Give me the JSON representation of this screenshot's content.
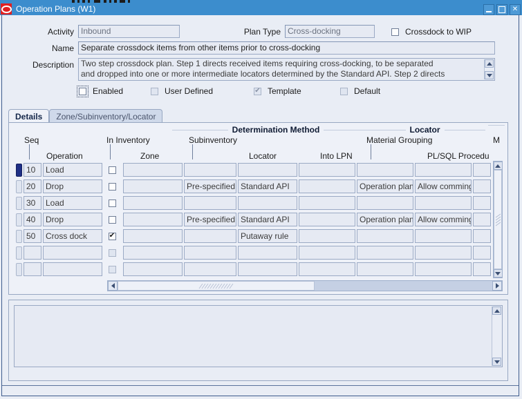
{
  "window": {
    "title": "Operation Plans (W1)",
    "icon": "oracle-logo-icon",
    "minimize_label": "_",
    "maximize_label": "□",
    "close_label": "✕"
  },
  "header_form": {
    "activity_label": "Activity",
    "activity_value": "Inbound",
    "plan_type_label": "Plan Type",
    "plan_type_value": "Cross-docking",
    "crossdock_to_wip_label": "Crossdock to WIP",
    "crossdock_to_wip_checked": false,
    "name_label": "Name",
    "name_value": "Separate crossdock items from other items prior to cross-docking",
    "description_label": "Description",
    "description_line1": "Two step crossdock plan.  Step 1 directs received items requiring cross-docking, to be separated",
    "description_line2": "and dropped into one or more intermediate locators determined by the Standard API.  Step 2 directs"
  },
  "flags": [
    {
      "label": "Enabled",
      "checked": false,
      "disabled": false,
      "focused": true
    },
    {
      "label": "User Defined",
      "checked": false,
      "disabled": true,
      "focused": false
    },
    {
      "label": "Template",
      "checked": true,
      "disabled": true,
      "focused": false
    },
    {
      "label": "Default",
      "checked": false,
      "disabled": true,
      "focused": false
    }
  ],
  "tabs": [
    {
      "label": "Details",
      "active": true
    },
    {
      "label": "Zone/Subinventory/Locator",
      "active": false
    }
  ],
  "grid": {
    "group_headers": [
      {
        "label": "Determination Method"
      },
      {
        "label": "Locator"
      }
    ],
    "upper_headers": [
      {
        "label": "Seq"
      },
      {
        "label": "In Inventory"
      },
      {
        "label": "Subinventory"
      },
      {
        "label": "Material Grouping"
      },
      {
        "label": "M"
      }
    ],
    "lower_headers": [
      {
        "label": "Operation"
      },
      {
        "label": "Zone"
      },
      {
        "label": "Locator"
      },
      {
        "label": "Into LPN"
      },
      {
        "label": "PL/SQL Procedu"
      }
    ],
    "rows": [
      {
        "selected": true,
        "seq": "10",
        "operation": "Load",
        "in_inventory": false,
        "zone": "",
        "subinventory": "",
        "locator": "",
        "into_lpn": "",
        "material_grouping": "",
        "plsql": "",
        "extra": ""
      },
      {
        "selected": false,
        "seq": "20",
        "operation": "Drop",
        "in_inventory": false,
        "zone": "",
        "subinventory": "Pre-specified",
        "locator": "Standard API",
        "into_lpn": "",
        "material_grouping": "Operation plan",
        "plsql": "Allow commingl",
        "extra": ""
      },
      {
        "selected": false,
        "seq": "30",
        "operation": "Load",
        "in_inventory": false,
        "zone": "",
        "subinventory": "",
        "locator": "",
        "into_lpn": "",
        "material_grouping": "",
        "plsql": "",
        "extra": ""
      },
      {
        "selected": false,
        "seq": "40",
        "operation": "Drop",
        "in_inventory": false,
        "zone": "",
        "subinventory": "Pre-specified",
        "locator": "Standard API",
        "into_lpn": "",
        "material_grouping": "Operation plan",
        "plsql": "Allow commingl",
        "extra": ""
      },
      {
        "selected": false,
        "seq": "50",
        "operation": "Cross dock",
        "in_inventory": true,
        "zone": "",
        "subinventory": "",
        "locator": "Putaway rule",
        "into_lpn": "",
        "material_grouping": "",
        "plsql": "",
        "extra": ""
      },
      {
        "selected": false,
        "seq": "",
        "operation": "",
        "in_inventory": false,
        "zone": "",
        "subinventory": "",
        "locator": "",
        "into_lpn": "",
        "material_grouping": "",
        "plsql": "",
        "extra": ""
      },
      {
        "selected": false,
        "seq": "",
        "operation": "",
        "in_inventory": false,
        "zone": "",
        "subinventory": "",
        "locator": "",
        "into_lpn": "",
        "material_grouping": "",
        "plsql": "",
        "extra": ""
      }
    ]
  },
  "message_area": {
    "value": ""
  },
  "colors": {
    "titlebar": "#3c8dcd",
    "window_bg": "#e9edf5",
    "field_bg": "#e6eaf3",
    "field_border": "#9aa9c4",
    "selected_row": "#1f2f86",
    "frame_border": "#3e5b8c"
  }
}
